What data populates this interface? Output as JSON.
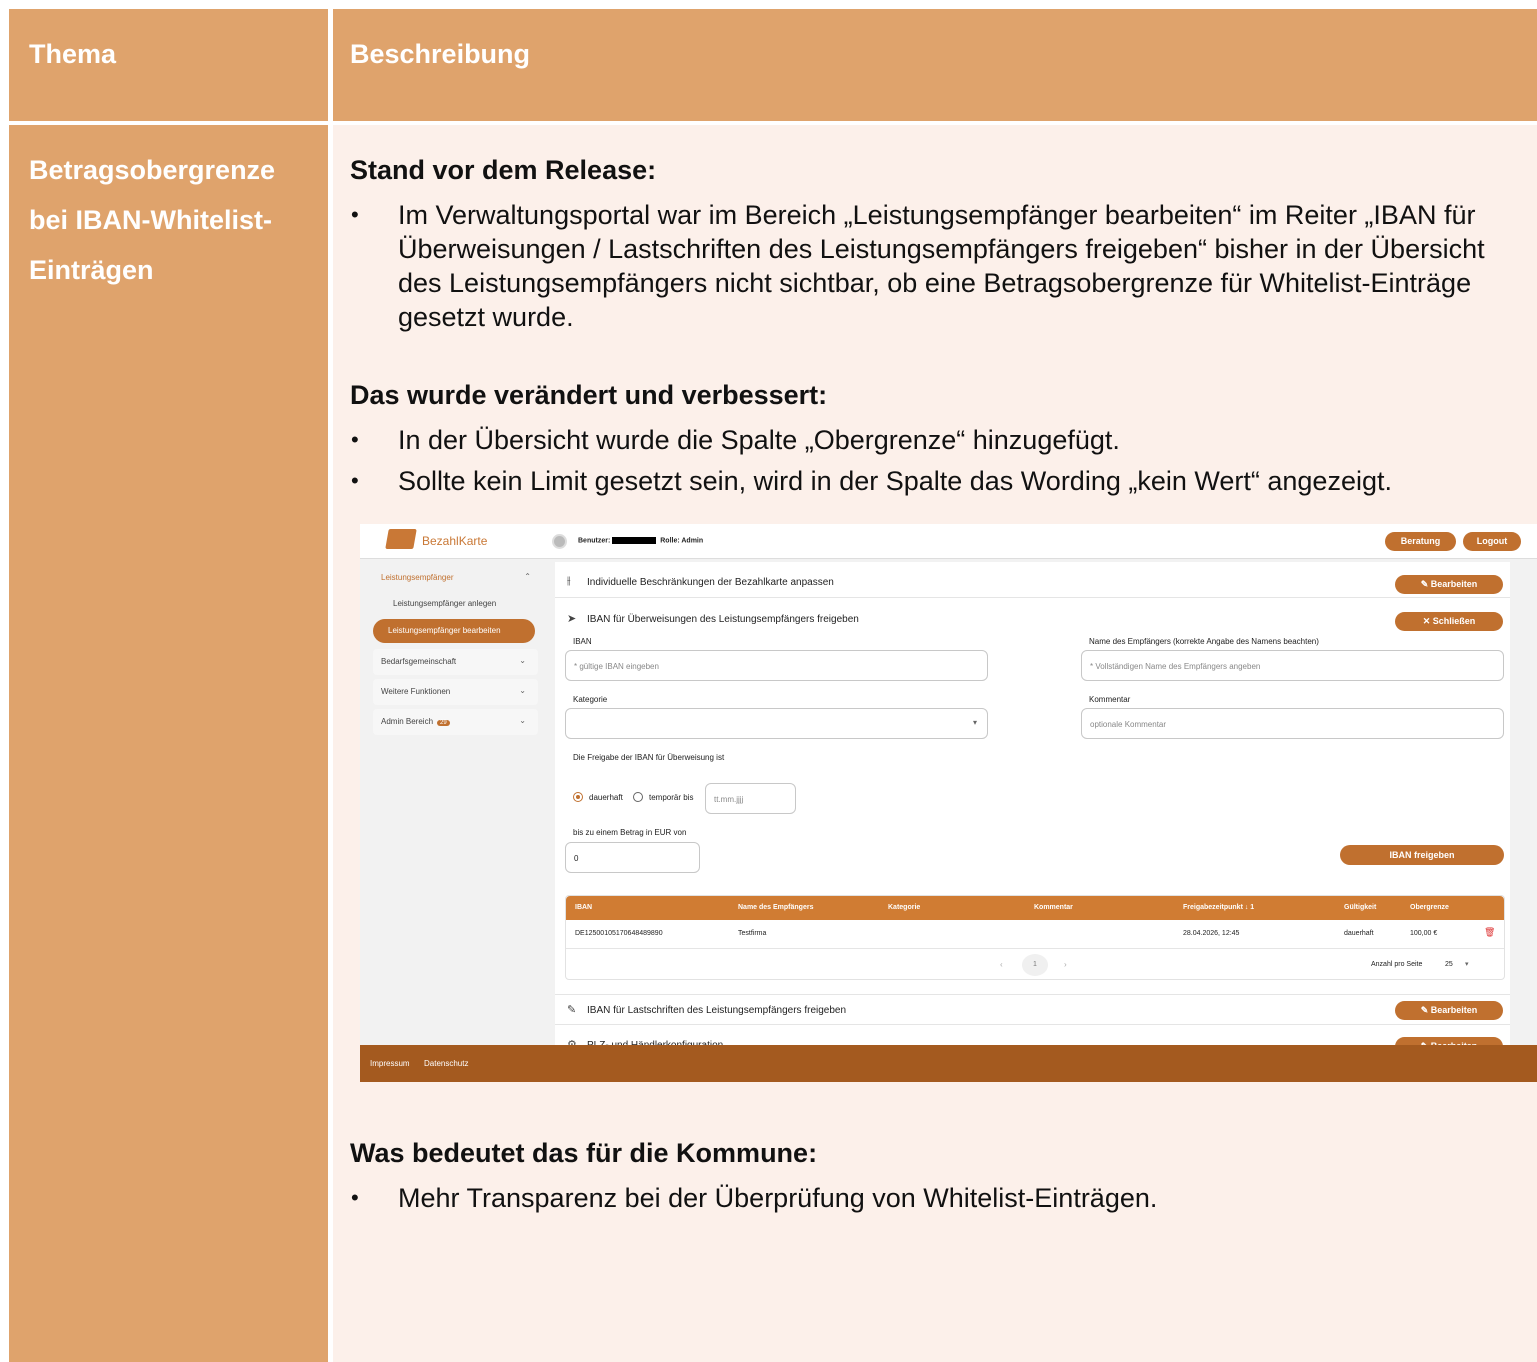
{
  "header": {
    "topic": "Thema",
    "description": "Beschreibung"
  },
  "topic": {
    "line1": "Betragsobergrenze",
    "line2": "bei IBAN-Whitelist-",
    "line3": "Einträgen"
  },
  "section1": {
    "title": "Stand vor dem Release:",
    "bullets": [
      "Im Verwaltungsportal war im Bereich „Leistungsempfänger bearbeiten“ im Reiter „IBAN für Überweisungen / Lastschriften des Leistungsempfängers freigeben“ bisher in der Übersicht des Leistungsempfängers nicht sichtbar, ob eine Betragsobergrenze für Whitelist-Einträge gesetzt wurde."
    ]
  },
  "section2": {
    "title": "Das wurde verändert und verbessert:",
    "bullets": [
      "In der Übersicht wurde die Spalte „Obergrenze“ hinzugefügt.",
      "Sollte kein Limit gesetzt sein, wird in der Spalte das Wording „kein Wert“ angezeigt."
    ]
  },
  "section3": {
    "title": "Was bedeutet das für die Kommune:",
    "bullets": [
      "Mehr Transparenz bei der Überprüfung von Whitelist-Einträgen."
    ]
  },
  "screenshot": {
    "logo": "BezahlKarte",
    "user_prefix": "Benutzer:",
    "role": "Rolle: Admin",
    "btn_beratung": "Beratung",
    "btn_logout": "Logout",
    "sidebar": {
      "group1": "Leistungsempfänger",
      "sub1": "Leistungsempfänger anlegen",
      "sub2": "Leistungsempfänger bearbeiten",
      "group2": "Bedarfsgemeinschaft",
      "group3": "Weitere Funktionen",
      "group4": "Admin Bereich",
      "badge": "29"
    },
    "strip1": "Individuelle Beschränkungen der Bezahlkarte anpassen",
    "btn_bearbeiten": "Bearbeiten",
    "strip2": "IBAN für Überweisungen des Leistungsempfängers freigeben",
    "btn_schliessen": "Schließen",
    "label_iban": "IBAN",
    "ph_iban": "* gültige IBAN eingeben",
    "label_name": "Name des Empfängers (korrekte Angabe des Namens beachten)",
    "ph_name": "* Vollständigen Name des Empfängers angeben",
    "label_kategorie": "Kategorie",
    "label_kommentar": "Kommentar",
    "ph_kommentar": "optionale Kommentar",
    "freigabe_text": "Die Freigabe der IBAN für Überweisung ist",
    "radio_dauerhaft": "dauerhaft",
    "radio_temporaer": "temporär bis",
    "ph_date": "tt.mm.jjjj",
    "label_betrag": "bis zu einem Betrag in EUR von",
    "betrag_value": "0",
    "btn_iban_freigeben": "IBAN freigeben",
    "table_headers": {
      "iban": "IBAN",
      "name": "Name des Empfängers",
      "kategorie": "Kategorie",
      "kommentar": "Kommentar",
      "freigabe": "Freigabezeitpunkt ↓ 1",
      "gueltigkeit": "Gültigkeit",
      "obergrenze": "Obergrenze"
    },
    "row": {
      "iban": "DE12500105170648489890",
      "name": "Testfirma",
      "freigabe": "28.04.2026, 12:45",
      "gueltigkeit": "dauerhaft",
      "obergrenze": "100,00 €"
    },
    "page_number": "1",
    "per_page_label": "Anzahl pro Seite",
    "per_page_value": "25",
    "strip3": "IBAN für Lastschriften des Leistungsempfängers freigeben",
    "strip4": "PLZ- und Händlerkonfiguration",
    "footer_impressum": "Impressum",
    "footer_datenschutz": "Datenschutz"
  }
}
